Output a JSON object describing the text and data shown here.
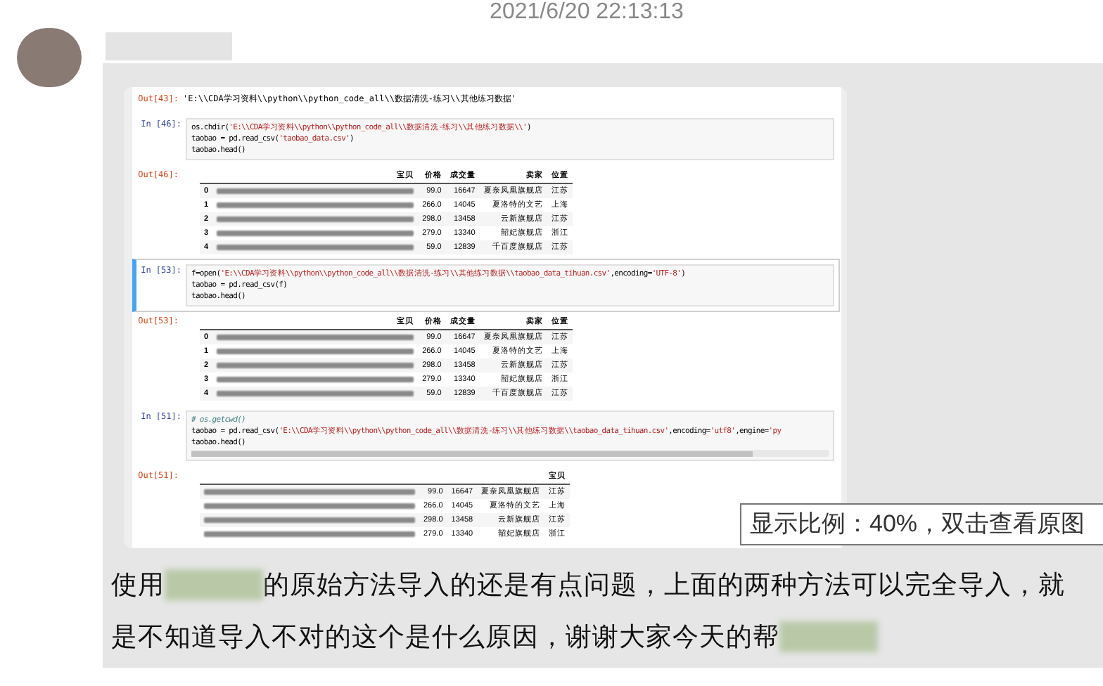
{
  "timestamp": "2021/6/20 22:13:13",
  "notebook": {
    "cells": [
      {
        "kind": "output_text",
        "prompt": "Out[43]:",
        "text": "'E:\\\\CDA学习资料\\\\python\\\\python_code_all\\\\数据清洗-练习\\\\其他练习数据'"
      },
      {
        "kind": "code",
        "prompt": "In [46]:",
        "selected": false,
        "scrollbar": false,
        "lines": [
          [
            {
              "kind": "plain",
              "text": "os.chdir("
            },
            {
              "kind": "string",
              "text": "'E:\\\\CDA学习资料\\\\python\\\\python_code_all\\\\数据清洗-练习\\\\其他练习数据\\\\'"
            },
            {
              "kind": "plain",
              "text": ")"
            }
          ],
          [
            {
              "kind": "plain",
              "text": "taobao = pd.read_csv("
            },
            {
              "kind": "string",
              "text": "'taobao_data.csv'"
            },
            {
              "kind": "plain",
              "text": ")"
            }
          ],
          [
            {
              "kind": "plain",
              "text": "taobao.head()"
            }
          ]
        ]
      },
      {
        "kind": "table",
        "prompt": "Out[46]:",
        "header": [
          "宝贝",
          "价格",
          "成交量",
          "卖家",
          "位置"
        ],
        "rows": [
          {
            "index": "0",
            "price": "99.0",
            "volume": "16647",
            "seller": "夏奈凤凰旗舰店",
            "location": "江苏"
          },
          {
            "index": "1",
            "price": "266.0",
            "volume": "14045",
            "seller": "夏洛特的文艺",
            "location": "上海"
          },
          {
            "index": "2",
            "price": "298.0",
            "volume": "13458",
            "seller": "云新旗舰店",
            "location": "江苏"
          },
          {
            "index": "3",
            "price": "279.0",
            "volume": "13340",
            "seller": "韶妃旗舰店",
            "location": "浙江"
          },
          {
            "index": "4",
            "price": "59.0",
            "volume": "12839",
            "seller": "千百度旗舰店",
            "location": "江苏"
          }
        ]
      },
      {
        "kind": "code",
        "prompt": "In [53]:",
        "selected": true,
        "scrollbar": false,
        "lines": [
          [
            {
              "kind": "plain",
              "text": "f=open("
            },
            {
              "kind": "string",
              "text": "'E:\\\\CDA学习资料\\\\python\\\\python_code_all\\\\数据清洗-练习\\\\其他练习数据\\\\taobao_data_tihuan.csv'"
            },
            {
              "kind": "plain",
              "text": ",encoding="
            },
            {
              "kind": "string",
              "text": "'UTF-8'"
            },
            {
              "kind": "plain",
              "text": ")"
            }
          ],
          [
            {
              "kind": "plain",
              "text": "taobao = pd.read_csv(f)"
            }
          ],
          [
            {
              "kind": "plain",
              "text": "taobao.head()"
            }
          ]
        ]
      },
      {
        "kind": "table",
        "prompt": "Out[53]:",
        "header": [
          "宝贝",
          "价格",
          "成交量",
          "卖家",
          "位置"
        ],
        "rows": [
          {
            "index": "0",
            "price": "99.0",
            "volume": "16647",
            "seller": "夏奈凤凰旗舰店",
            "location": "江苏"
          },
          {
            "index": "1",
            "price": "266.0",
            "volume": "14045",
            "seller": "夏洛特的文艺",
            "location": "上海"
          },
          {
            "index": "2",
            "price": "298.0",
            "volume": "13458",
            "seller": "云新旗舰店",
            "location": "江苏"
          },
          {
            "index": "3",
            "price": "279.0",
            "volume": "13340",
            "seller": "韶妃旗舰店",
            "location": "浙江"
          },
          {
            "index": "4",
            "price": "59.0",
            "volume": "12839",
            "seller": "千百度旗舰店",
            "location": "江苏"
          }
        ]
      },
      {
        "kind": "code",
        "prompt": "In [51]:",
        "selected": false,
        "scrollbar": true,
        "lines": [
          [
            {
              "kind": "comment",
              "text": "# os.getcwd()"
            }
          ],
          [
            {
              "kind": "plain",
              "text": "taobao = pd.read_csv("
            },
            {
              "kind": "string",
              "text": "'E:\\\\CDA学习资料\\\\python\\\\python_code_all\\\\数据清洗-练习\\\\其他练习数据\\\\taobao_data_tihuan.csv'"
            },
            {
              "kind": "plain",
              "text": ",encoding="
            },
            {
              "kind": "string",
              "text": "'utf8'"
            },
            {
              "kind": "plain",
              "text": ",engine="
            },
            {
              "kind": "string",
              "text": "'py"
            }
          ],
          [
            {
              "kind": "plain",
              "text": "taobao.head()"
            }
          ]
        ]
      },
      {
        "kind": "table",
        "prompt": "Out[51]:",
        "header": [
          "宝贝"
        ],
        "rows": [
          {
            "price": "99.0",
            "volume": "16647",
            "seller": "夏奈凤凰旗舰店",
            "location": "江苏"
          },
          {
            "price": "266.0",
            "volume": "14045",
            "seller": "夏洛特的文艺",
            "location": "上海"
          },
          {
            "price": "298.0",
            "volume": "13458",
            "seller": "云新旗舰店",
            "location": "江苏"
          },
          {
            "price": "279.0",
            "volume": "13340",
            "seller": "韶妃旗舰店",
            "location": "浙江"
          }
        ]
      }
    ]
  },
  "zoom_tooltip": "显示比例：40%，双击查看原图",
  "message_lines": [
    [
      {
        "kind": "text",
        "text": "使用"
      },
      {
        "kind": "blur"
      },
      {
        "kind": "text",
        "text": "的原始方法导入的还是有点问题，上面的两种方法可以完全导入，就"
      }
    ],
    [
      {
        "kind": "text",
        "text": "是不知道导入不对的这个是什么原因，谢谢大家今天的帮"
      },
      {
        "kind": "blur"
      }
    ]
  ]
}
